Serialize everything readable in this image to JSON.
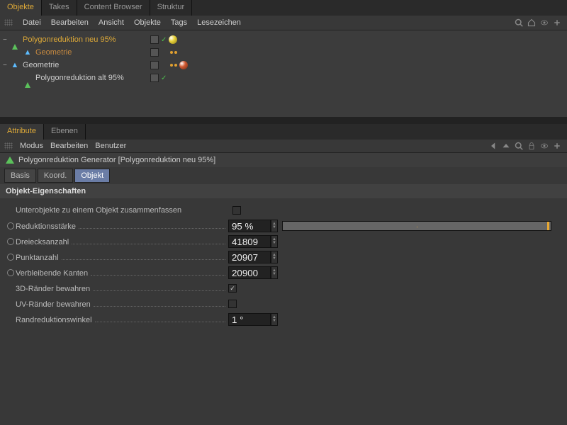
{
  "top_tabs": {
    "active_index": 0,
    "items": [
      "Objekte",
      "Takes",
      "Content Browser",
      "Struktur"
    ]
  },
  "object_menubar": {
    "items": [
      "Datei",
      "Bearbeiten",
      "Ansicht",
      "Objekte",
      "Tags",
      "Lesezeichen"
    ]
  },
  "tree": {
    "rows": [
      {
        "indent": 0,
        "expander": "−",
        "icon": "green-triangle",
        "label": "Polygonreduktion neu 95%",
        "class": "highlight1",
        "tags": [
          "tagbox",
          "greencheck",
          "sphere-yellow"
        ]
      },
      {
        "indent": 1,
        "expander": "",
        "icon": "blue-triangle",
        "label": "Geometrie",
        "class": "highlight2",
        "tags": [
          "tagbox",
          "",
          "dots"
        ]
      },
      {
        "indent": 0,
        "expander": "−",
        "icon": "blue-triangle",
        "label": "Geometrie",
        "class": "",
        "tags": [
          "tagbox",
          "",
          "dots",
          "sphere-red"
        ]
      },
      {
        "indent": 1,
        "expander": "",
        "icon": "green-triangle",
        "label": "Polygonreduktion alt 95%",
        "class": "",
        "tags": [
          "tagbox",
          "greencheck"
        ]
      }
    ]
  },
  "attr_tabs": {
    "active_index": 0,
    "items": [
      "Attribute",
      "Ebenen"
    ]
  },
  "attr_menubar": {
    "items": [
      "Modus",
      "Bearbeiten",
      "Benutzer"
    ]
  },
  "object_title": "Polygonreduktion Generator [Polygonreduktion neu 95%]",
  "subtabs": {
    "active_index": 2,
    "items": [
      "Basis",
      "Koord.",
      "Objekt"
    ]
  },
  "section_header": "Objekt-Eigenschaften",
  "props": {
    "merge": {
      "label": "Unterobjekte zu einem Objekt zusammenfassen",
      "type": "checkbox",
      "checked": false,
      "radio": false
    },
    "reduce": {
      "label": "Reduktionsstärke",
      "value": "95 %",
      "type": "slider",
      "radio": true
    },
    "tris": {
      "label": "Dreiecksanzahl",
      "value": "41809",
      "type": "number",
      "radio": true
    },
    "points": {
      "label": "Punktanzahl",
      "value": "20907",
      "type": "number",
      "radio": true
    },
    "edges": {
      "label": "Verbleibende Kanten",
      "value": "20900",
      "type": "number",
      "radio": true
    },
    "keep3d": {
      "label": "3D-Ränder bewahren",
      "type": "checkbox",
      "checked": true,
      "radio": false
    },
    "keepuv": {
      "label": "UV-Ränder bewahren",
      "type": "checkbox",
      "checked": false,
      "radio": false
    },
    "angle": {
      "label": "Randreduktionswinkel",
      "value": "1 °",
      "type": "number",
      "radio": false
    }
  }
}
